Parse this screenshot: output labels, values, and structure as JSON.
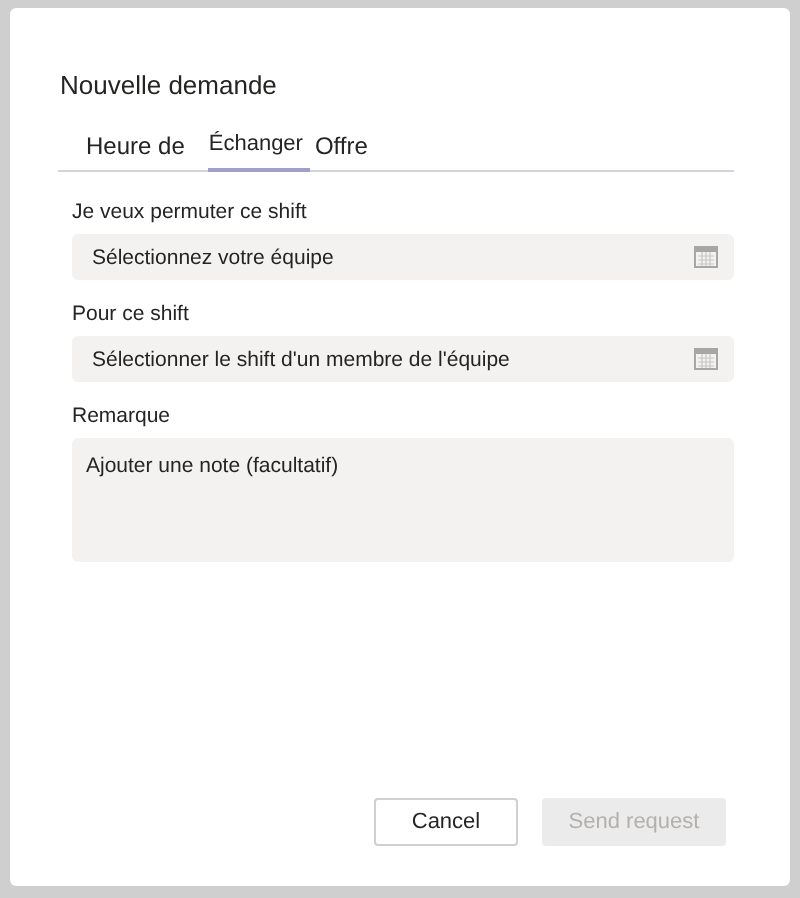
{
  "dialog": {
    "title": "Nouvelle demande"
  },
  "tabs": [
    {
      "label": "Heure de",
      "selected": false
    },
    {
      "label": "Échanger",
      "selected": true
    },
    {
      "label": "Offre",
      "selected": false
    }
  ],
  "fields": [
    {
      "kind": "picker",
      "label": "Je veux permuter ce shift",
      "placeholder": "Sélectionnez votre équipe"
    },
    {
      "kind": "picker",
      "label": "Pour ce shift",
      "placeholder": "Sélectionner le shift d'un membre de l'équipe"
    },
    {
      "kind": "note",
      "label": "Remarque",
      "placeholder": "Ajouter une note (facultatif)"
    }
  ],
  "buttons": [
    {
      "label": "Cancel",
      "disabled": false
    },
    {
      "label": "Send request",
      "disabled": true
    }
  ]
}
